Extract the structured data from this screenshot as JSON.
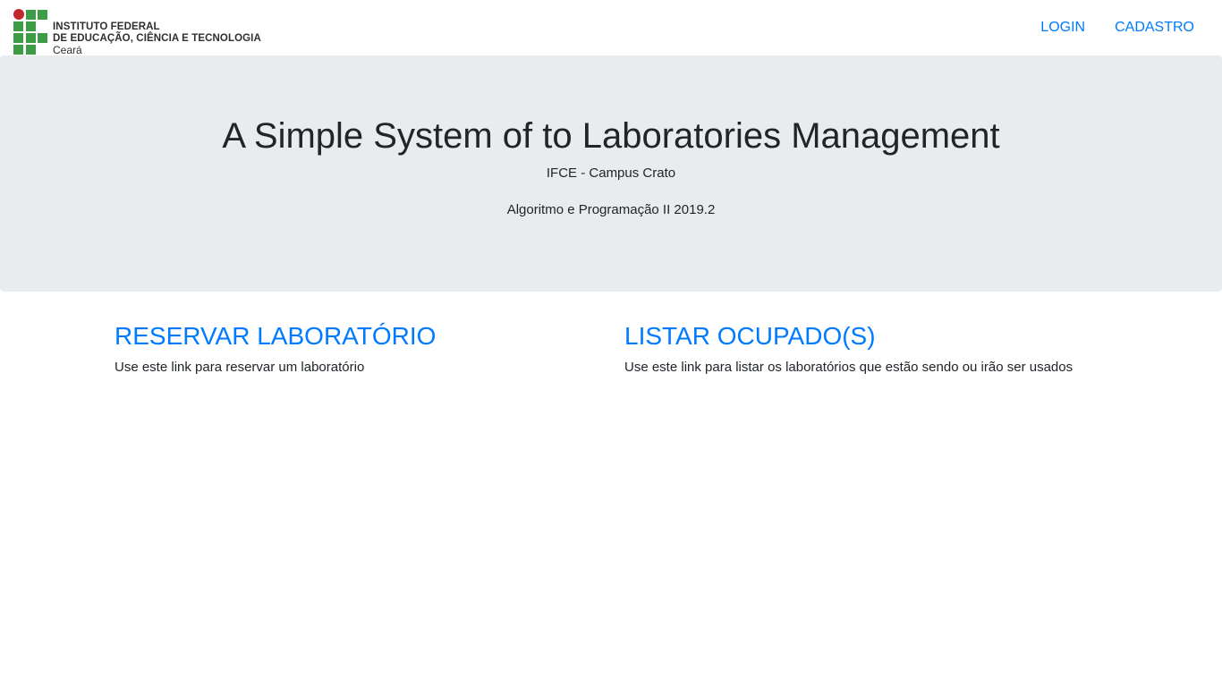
{
  "brand": {
    "line1": "INSTITUTO FEDERAL",
    "line2": "DE EDUCAÇÃO, CIÊNCIA E TECNOLOGIA",
    "line3": "Ceará",
    "green": "#3d9c46",
    "red": "#c4262e"
  },
  "nav": {
    "login": "LOGIN",
    "cadastro": "CADASTRO"
  },
  "hero": {
    "title": "A Simple System of to Laboratories Management",
    "subtitle": "IFCE - Campus Crato",
    "course": "Algoritmo e Programação II 2019.2"
  },
  "sections": [
    {
      "title": "RESERVAR LABORATÓRIO",
      "description": "Use este link para reservar um laboratório"
    },
    {
      "title": "LISTAR OCUPADO(S)",
      "description": "Use este link para listar os laboratórios que estão sendo ou irão ser usados"
    }
  ],
  "colors": {
    "link": "#007bff",
    "jumbotron_bg": "#e9ecef",
    "text": "#212529"
  }
}
